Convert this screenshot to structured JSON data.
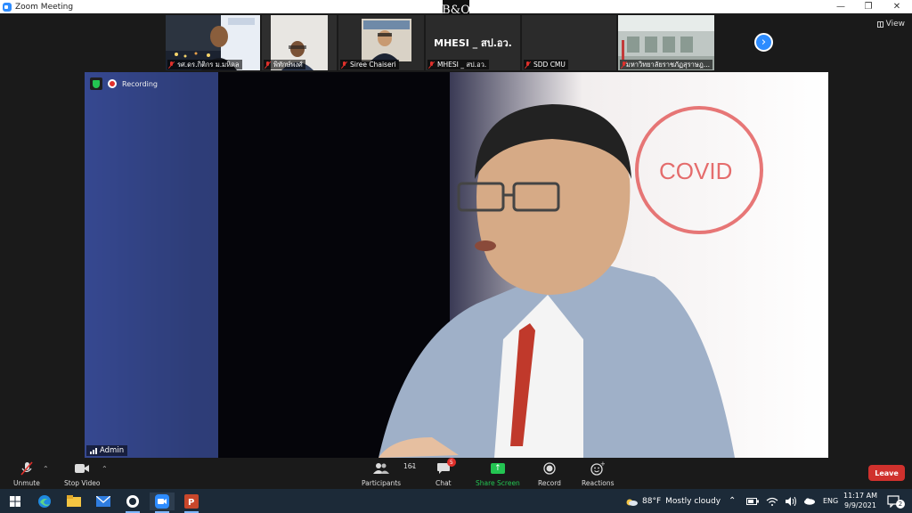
{
  "window": {
    "title": "Zoom Meeting",
    "brand_logo": "B&O",
    "view_label": "View"
  },
  "participants_strip": [
    {
      "name": "รศ.ดร.กิติกร ม.มหิดล",
      "muted": true,
      "has_video": true
    },
    {
      "name": "พิทักษ์พงศ์",
      "muted": true,
      "has_video": true
    },
    {
      "name": "Siree Chaiseri",
      "muted": true,
      "has_video": true
    },
    {
      "name": "MHESI _ สป.อว.",
      "display_text": "MHESI _ สป.อว.",
      "muted": true,
      "has_video": false
    },
    {
      "name": "SDD CMU",
      "muted": true,
      "has_video": false
    },
    {
      "name": "มหาวิทยาลัยราชภัฏสุราษฎ...",
      "muted": true,
      "has_video": true
    }
  ],
  "main_video": {
    "recording_label": "Recording",
    "speaker_name": "Admin"
  },
  "toolbar": {
    "unmute": "Unmute",
    "stop_video": "Stop Video",
    "participants": "Participants",
    "participants_count": "161",
    "chat": "Chat",
    "chat_badge": "5",
    "share_screen": "Share Screen",
    "record": "Record",
    "reactions": "Reactions",
    "leave": "Leave"
  },
  "taskbar": {
    "weather_temp": "88°F",
    "weather_desc": "Mostly cloudy",
    "language": "ENG",
    "time": "11:17 AM",
    "date": "9/9/2021",
    "notification_count": "2"
  },
  "colors": {
    "accent": "#2d8cff",
    "leave": "#d0312d",
    "share": "#23c552",
    "muted": "#e0302b"
  }
}
